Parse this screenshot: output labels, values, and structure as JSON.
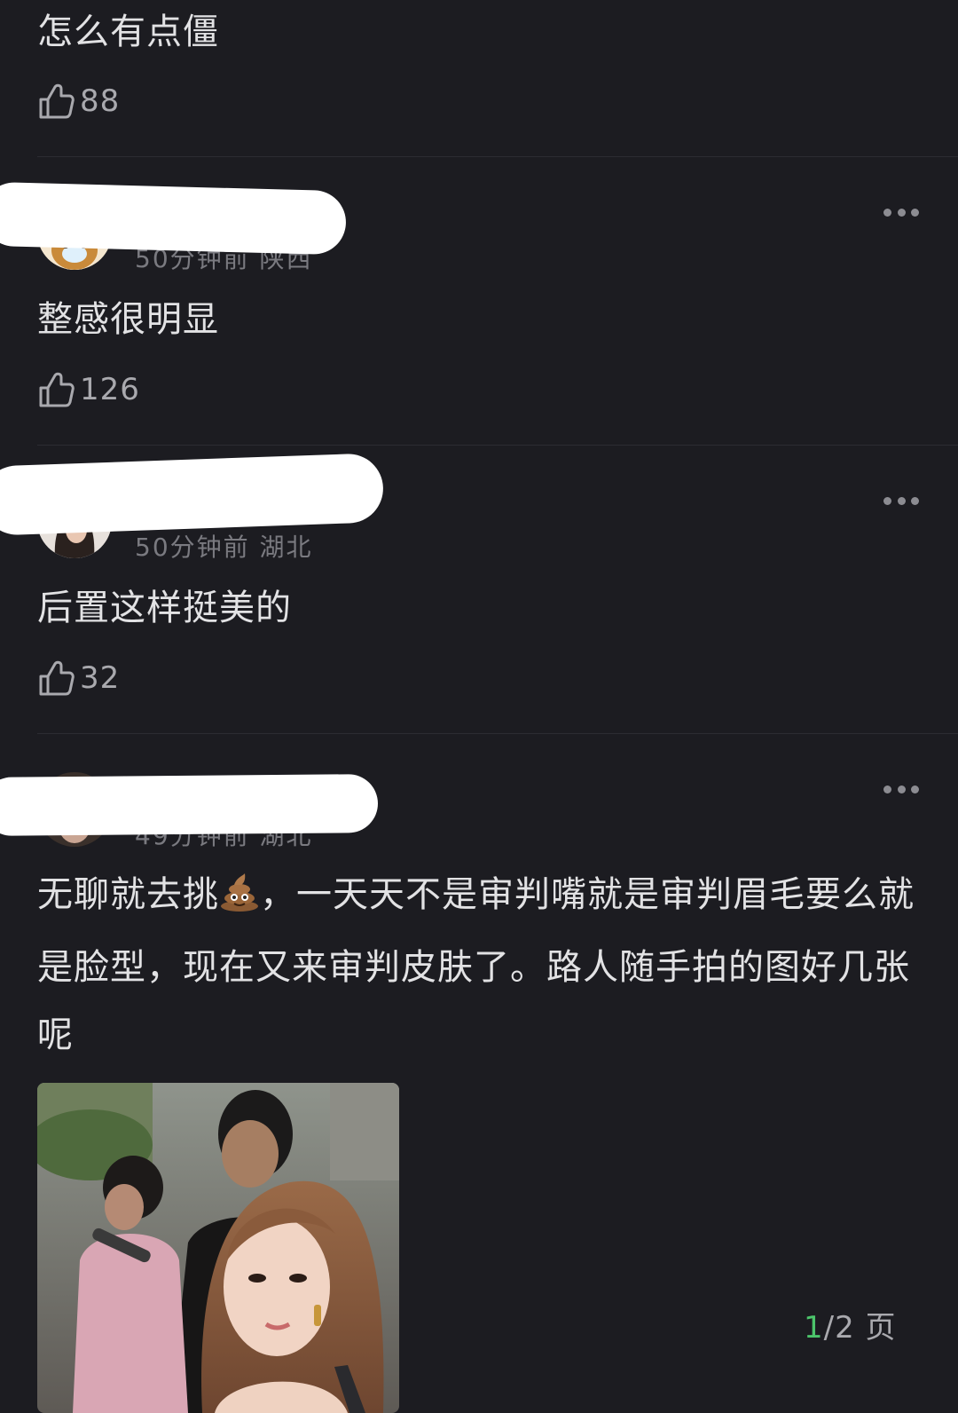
{
  "comments": [
    {
      "text": "怎么有点僵",
      "likes": "88"
    },
    {
      "meta": "50分钟前 陕西",
      "text": "整感很明显",
      "likes": "126"
    },
    {
      "meta": "50分钟前 湖北",
      "text": "后置这样挺美的",
      "likes": "32"
    },
    {
      "meta": "49分钟前 湖北",
      "text_before_emoji": "无聊就去挑",
      "emoji": "pile-of-poo-icon",
      "text_after_emoji": "，一天天不是审判嘴就是审判眉毛要么就是脸型，现在又来审判皮肤了。路人随手拍的图好几张呢"
    }
  ],
  "pager": {
    "current": "1",
    "rest": "/2 页"
  },
  "colors": {
    "background": "#1c1c21",
    "pager_current": "#4cc46b"
  }
}
